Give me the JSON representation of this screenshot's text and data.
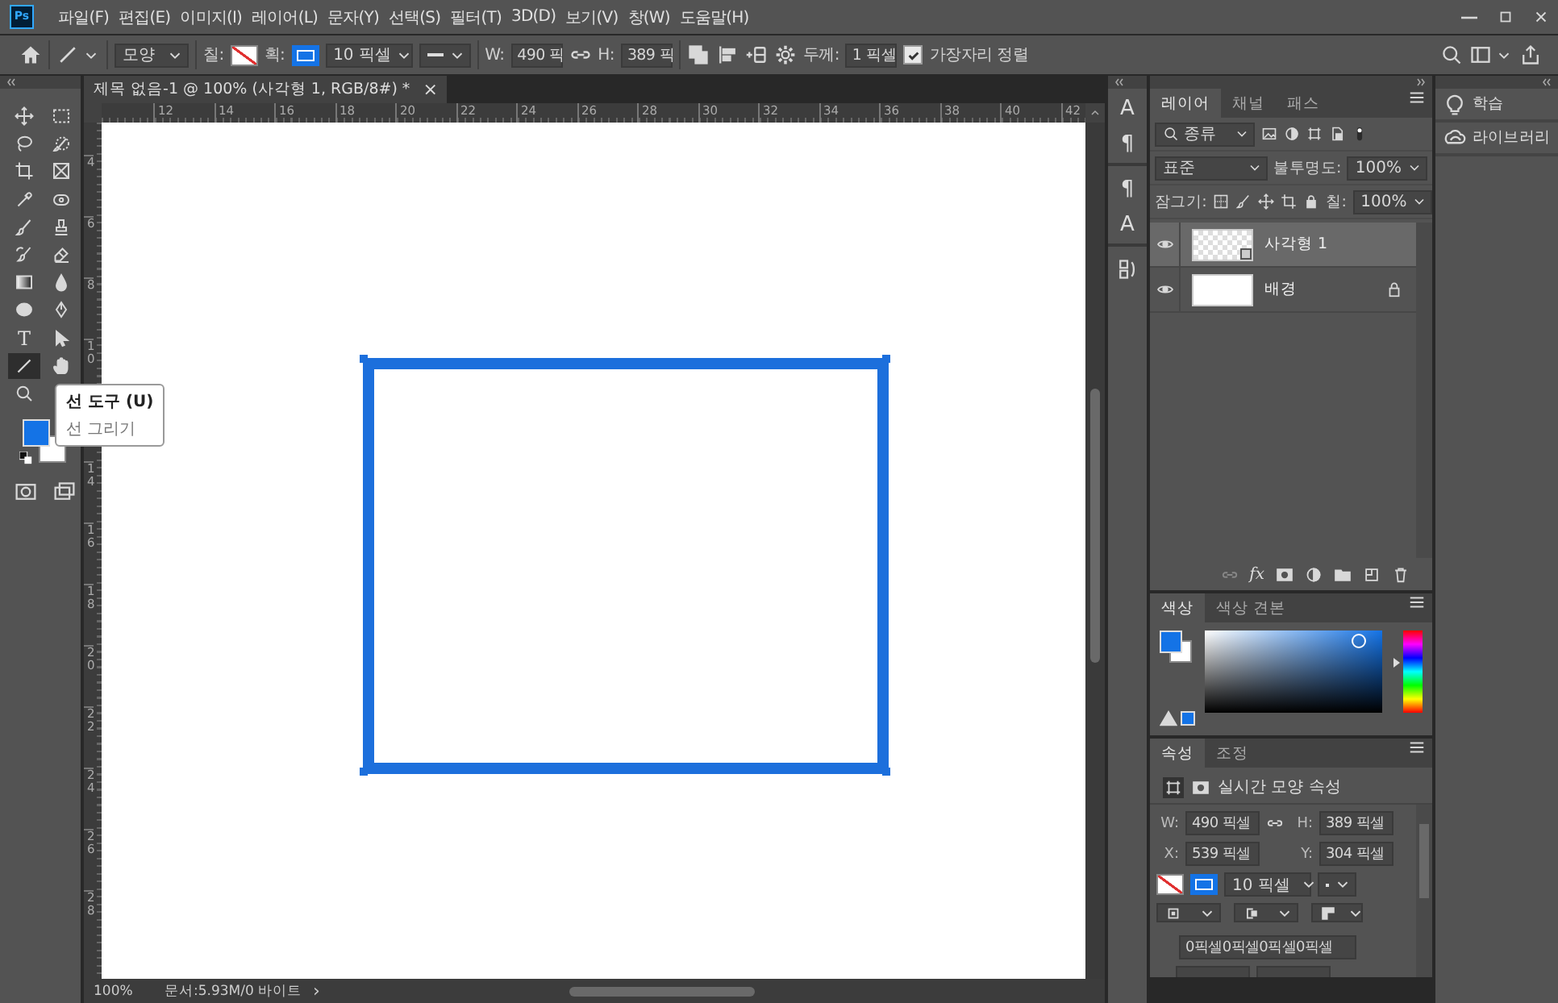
{
  "app": {
    "logo": "Ps",
    "menu": [
      "파일(F)",
      "편집(E)",
      "이미지(I)",
      "레이어(L)",
      "문자(Y)",
      "선택(S)",
      "필터(T)",
      "3D(D)",
      "보기(V)",
      "창(W)",
      "도움말(H)"
    ]
  },
  "options_bar": {
    "shape_mode": "모양",
    "fill_label": "칠:",
    "stroke_label": "획:",
    "stroke_width": "10 픽셀",
    "w_label": "W:",
    "w_value": "490 픽",
    "h_label": "H:",
    "h_value": "389 픽",
    "weight_label": "두께:",
    "weight_value": "1 픽셀",
    "align_edges": {
      "label": "가장자리 정렬",
      "checked": true
    }
  },
  "tools": [
    {
      "kind": "move",
      "selected": false
    },
    {
      "kind": "marquee",
      "selected": false
    },
    {
      "kind": "lasso",
      "selected": false
    },
    {
      "kind": "select-brush",
      "selected": false
    },
    {
      "kind": "crop",
      "selected": false
    },
    {
      "kind": "frame",
      "selected": false
    },
    {
      "kind": "eyedropper",
      "selected": false
    },
    {
      "kind": "bandage",
      "selected": false
    },
    {
      "kind": "brush",
      "selected": false
    },
    {
      "kind": "stamp",
      "selected": false
    },
    {
      "kind": "history-brush",
      "selected": false
    },
    {
      "kind": "eraser",
      "selected": false
    },
    {
      "kind": "gradient",
      "selected": false
    },
    {
      "kind": "drop",
      "selected": false
    },
    {
      "kind": "sponge",
      "selected": false
    },
    {
      "kind": "pen",
      "selected": false
    },
    {
      "kind": "type",
      "glyph": "T",
      "selected": false
    },
    {
      "kind": "arrow",
      "selected": false
    },
    {
      "kind": "line",
      "selected": true
    },
    {
      "kind": "hand",
      "selected": false
    },
    {
      "kind": "magnifier",
      "selected": false
    }
  ],
  "tooltip": {
    "title": "선 도구 (U)",
    "description": "선 그리기"
  },
  "document": {
    "tab_title": "제목 없음-1 @ 100% (사각형 1, RGB/8#) *",
    "close": "×",
    "zoom": "100%",
    "doc_info": "문서:5.93M/0 바이트",
    "info_arrow": "›"
  },
  "rulers": {
    "horizontal": [
      "12",
      "14",
      "16",
      "18",
      "20",
      "22",
      "24",
      "26",
      "28",
      "30",
      "32",
      "34",
      "36",
      "38",
      "40",
      "42"
    ],
    "vertical": [
      "4",
      "6",
      "8",
      "10",
      "14",
      "16",
      "18",
      "20",
      "22",
      "24",
      "26",
      "28"
    ]
  },
  "mini_panels": [
    {
      "kind": "character",
      "glyph": "A"
    },
    {
      "kind": "paragraph",
      "glyph": "¶"
    },
    {
      "kind": "paragraph-style",
      "glyph": "¶"
    },
    {
      "kind": "character-style",
      "glyph": "A"
    },
    {
      "kind": "glyphs"
    }
  ],
  "layers_panel": {
    "tabs": [
      {
        "label": "레이어",
        "selected": true
      },
      {
        "label": "채널",
        "selected": false
      },
      {
        "label": "패스",
        "selected": false
      }
    ],
    "filter": "종류",
    "blend_mode": "표준",
    "opacity_label": "불투명도:",
    "opacity": "100%",
    "lock_label": "잠그기:",
    "fill_label": "칠:",
    "fill": "100%",
    "layers": [
      {
        "name": "사각형 1",
        "kind": "shape",
        "visible": true,
        "selected": true,
        "locked": false
      },
      {
        "name": "배경",
        "kind": "background",
        "visible": true,
        "selected": false,
        "locked": true
      }
    ],
    "footer_fx": "fx"
  },
  "color_panel": {
    "tabs": [
      {
        "label": "색상",
        "selected": true
      },
      {
        "label": "색상 견본",
        "selected": false
      }
    ],
    "hue": {
      "level": 0.61
    }
  },
  "properties_panel": {
    "tabs": [
      {
        "label": "속성",
        "selected": true
      },
      {
        "label": "조정",
        "selected": false
      }
    ],
    "title": "실시간 모양 속성",
    "w_label": "W:",
    "w": "490 픽셀",
    "h_label": "H:",
    "h": "389 픽셀",
    "x_label": "X:",
    "x": "539 픽셀",
    "y_label": "Y:",
    "y": "304 픽셀",
    "stroke_width": "10 픽셀",
    "corner_radii": "0픽셀0픽셀0픽셀0픽셀"
  },
  "side_panels": [
    {
      "kind": "learn",
      "label": "학습"
    },
    {
      "kind": "libraries",
      "label": "라이브러리"
    }
  ]
}
